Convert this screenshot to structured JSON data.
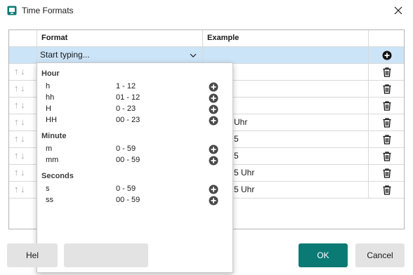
{
  "window": {
    "title": "Time Formats"
  },
  "grid": {
    "columns": {
      "format": "Format",
      "example": "Example"
    },
    "selected_row": {
      "format_input": "Start typing..."
    },
    "rows": [
      {
        "example": ""
      },
      {
        "example": ""
      },
      {
        "example": ""
      },
      {
        "example": "Uhr"
      },
      {
        "example": "5"
      },
      {
        "example": "5"
      },
      {
        "example": "5 Uhr"
      },
      {
        "example": "5 Uhr"
      }
    ]
  },
  "dropdown": {
    "groups": [
      {
        "label": "Hour",
        "options": [
          {
            "code": "h",
            "range": "1 - 12"
          },
          {
            "code": "hh",
            "range": "01 - 12"
          },
          {
            "code": "H",
            "range": "0 - 23"
          },
          {
            "code": "HH",
            "range": "00 - 23"
          }
        ]
      },
      {
        "label": "Minute",
        "options": [
          {
            "code": "m",
            "range": "0 - 59"
          },
          {
            "code": "mm",
            "range": "00 - 59"
          }
        ]
      },
      {
        "label": "Seconds",
        "options": [
          {
            "code": "s",
            "range": "0 - 59"
          },
          {
            "code": "ss",
            "range": "00 - 59"
          }
        ]
      }
    ]
  },
  "footer": {
    "help_label": "Hel",
    "ok_label": "OK",
    "cancel_label": "Cancel"
  },
  "icons": {
    "app": "window-app-icon",
    "close": "close-icon",
    "chevron": "chevron-down-icon",
    "add": "plus-circle-icon",
    "delete": "trash-icon",
    "move": "up-down-arrows-icon"
  },
  "colors": {
    "accent": "#0c7a74",
    "selection": "#cce4f7",
    "button_grey": "#e3e3e3"
  }
}
